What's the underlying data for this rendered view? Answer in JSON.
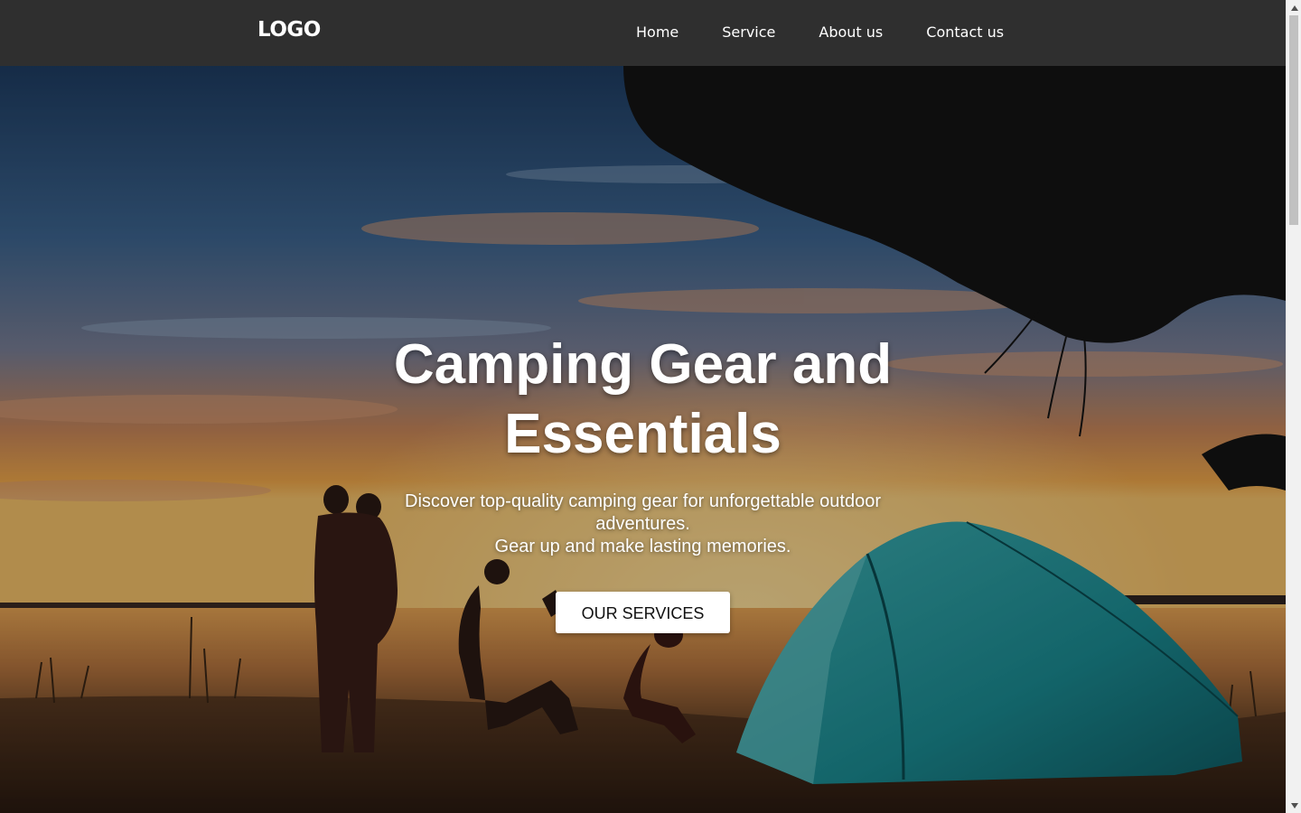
{
  "navbar": {
    "logo": "LOGO",
    "links": [
      {
        "label": "Home"
      },
      {
        "label": "Service"
      },
      {
        "label": "About us"
      },
      {
        "label": "Contact us"
      }
    ]
  },
  "hero": {
    "title": "Camping Gear and Essentials",
    "subtitle_line1": "Discover top-quality camping gear for unforgettable outdoor adventures.",
    "subtitle_line2": "Gear up and make lasting memories.",
    "cta_label": "OUR SERVICES",
    "background_image": "sunset-camping-family-tent-photo"
  },
  "colors": {
    "navbar_bg": "#2f2f2f",
    "nav_text": "#ffffff",
    "cta_bg": "#ffffff",
    "cta_text": "#111111",
    "tent": "#1f8f95",
    "sky_top": "#2a4e76",
    "horizon": "#e8a04a"
  }
}
